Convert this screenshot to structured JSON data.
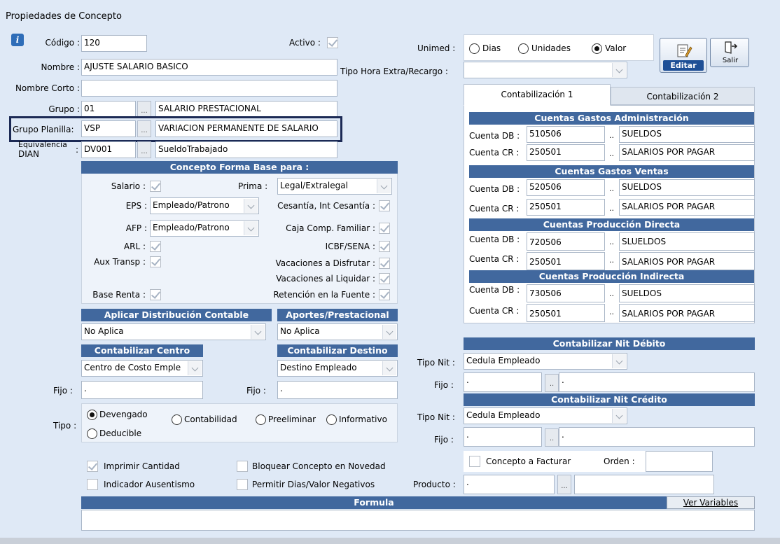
{
  "window": {
    "title": "Propiedades de Concepto"
  },
  "colors": {
    "header_bg": "#41689e",
    "highlight_border": "#1c2a55",
    "info_icon": "#2e6db8"
  },
  "general": {
    "codigo_label": "Código :",
    "codigo_value": "120",
    "activo_label": "Activo :",
    "nombre_label": "Nombre :",
    "nombre_value": "AJUSTE SALARIO BASICO",
    "nombre_corto_label": "Nombre Corto :",
    "nombre_corto_value": "",
    "grupo_label": "Grupo :",
    "grupo_code": "01",
    "grupo_desc": "SALARIO PRESTACIONAL",
    "grupo_planilla_label": "Grupo Planilla:",
    "grupo_planilla_code": "VSP",
    "grupo_planilla_desc": "VARIACION PERMANENTE DE SALARIO",
    "equivalencia_label_1": "Equivalencia",
    "equivalencia_label_2": "DIAN",
    "equivalencia_colon": ":",
    "equivalencia_code": "DV001",
    "equivalencia_desc": "SueldoTrabajado",
    "ellipsis": "..."
  },
  "unimed": {
    "label": "Unimed :",
    "options": [
      "Dias",
      "Unidades",
      "Valor"
    ],
    "selected": "Valor",
    "tipo_hora_label": "Tipo Hora Extra/Recargo :",
    "tipo_hora_value": ""
  },
  "toolbar": {
    "editar_label": "Editar",
    "salir_label": "Salir"
  },
  "forma_base": {
    "title": "Concepto Forma Base para :",
    "salario_label": "Salario :",
    "prima_label": "Prima :",
    "prima_value": "Legal/Extralegal",
    "eps_label": "EPS :",
    "eps_value": "Empleado/Patrono",
    "cesantia_label": "Cesantía, Int Cesantía :",
    "afp_label": "AFP :",
    "afp_value": "Empleado/Patrono",
    "caja_label": "Caja Comp. Familiar :",
    "arl_label": "ARL :",
    "icbf_label": "ICBF/SENA :",
    "aux_label": "Aux Transp :",
    "vac_disfrutar_label": "Vacaciones a Disfrutar :",
    "vac_liquidar_label": "Vacaciones al Liquidar :",
    "base_renta_label": "Base Renta :",
    "retencion_label": "Retención en la Fuente :"
  },
  "distribucion": {
    "aplicar_title": "Aplicar Distribución Contable",
    "aplicar_value": "No Aplica",
    "aportes_title": "Aportes/Prestacional",
    "aportes_value": "No Aplica",
    "centro_title": "Contabilizar Centro",
    "centro_value": "Centro de Costo Emple",
    "destino_title": "Contabilizar Destino",
    "destino_value": "Destino Empleado",
    "fijo_label": "Fijo :",
    "fijo_centro_value": ".",
    "fijo_destino_value": "."
  },
  "tipo": {
    "label": "Tipo :",
    "options": [
      "Devengado",
      "Contabilidad",
      "Preeliminar",
      "Informativo",
      "Deducible"
    ],
    "selected": "Devengado"
  },
  "opciones": {
    "imprimir_cantidad": "Imprimir Cantidad",
    "bloquear_concepto": "Bloquear Concepto en Novedad",
    "indicador_ausentismo": "Indicador Ausentismo",
    "permitir_negativos": "Permitir Dias/Valor Negativos"
  },
  "tabs": [
    {
      "label": "Contabilización 1"
    },
    {
      "label": "Contabilización 2"
    }
  ],
  "contabilizacion": {
    "db_label": "Cuenta DB :",
    "cr_label": "Cuenta CR :",
    "dots": "..",
    "groups": [
      {
        "title": "Cuentas Gastos Administración",
        "db_code": "510506",
        "db_name": "SUELDOS",
        "cr_code": "250501",
        "cr_name": "SALARIOS POR PAGAR"
      },
      {
        "title": "Cuentas Gastos Ventas",
        "db_code": "520506",
        "db_name": "SUELDOS",
        "cr_code": "250501",
        "cr_name": "SALARIOS POR PAGAR"
      },
      {
        "title": "Cuentas Producción Directa",
        "db_code": "720506",
        "db_name": "SLUELDOS",
        "cr_code": "250501",
        "cr_name": "SALARIOS POR PAGAR"
      },
      {
        "title": "Cuentas Producción Indirecta",
        "db_code": "730506",
        "db_name": "SUELDOS",
        "cr_code": "250501",
        "cr_name": "SALARIOS POR PAGAR"
      }
    ]
  },
  "nit": {
    "debito_title": "Contabilizar Nit Débito",
    "credito_title": "Contabilizar Nit Crédito",
    "tipo_nit_label": "Tipo Nit :",
    "fijo_label": "Fijo :",
    "debito_tipo": "Cedula Empleado",
    "debito_fijo": ".",
    "debito_fijo2": ".",
    "credito_tipo": "Cedula Empleado",
    "credito_fijo": ".",
    "credito_fijo2": "."
  },
  "facturar": {
    "concepto_label": "Concepto a Facturar",
    "orden_label": "Orden :",
    "orden_value": "",
    "producto_label": "Producto :",
    "producto_value": ".",
    "producto_desc": ""
  },
  "formula": {
    "title": "Formula",
    "ver_variables_label": "Ver Variables",
    "value": ""
  }
}
